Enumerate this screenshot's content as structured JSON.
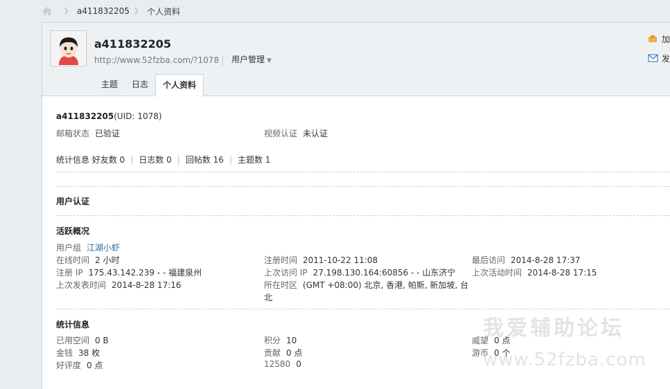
{
  "breadcrumb": {
    "items": [
      "a411832205",
      "个人资料"
    ]
  },
  "header": {
    "username": "a411832205",
    "url": "http://www.52fzba.com/?1078",
    "manage_label": "用户管理",
    "actions": [
      "加",
      "发"
    ]
  },
  "tabs": [
    {
      "label": "主题"
    },
    {
      "label": "日志"
    },
    {
      "label": "个人资料",
      "active": true
    }
  ],
  "info": {
    "name": "a411832205",
    "uid": "(UID: 1078)",
    "email_label": "邮箱状态",
    "email_value": "已验证",
    "video_label": "视频认证",
    "video_value": "未认证",
    "stats_label": "统计信息",
    "stats": [
      "好友数 0",
      "日志数 0",
      "回帖数 16",
      "主题数 1"
    ]
  },
  "verification": {
    "title": "用户认证"
  },
  "activity": {
    "title": "活跃概况",
    "group_label": "用户组",
    "group_value": "江湖小虾",
    "online_label": "在线时间",
    "online_value": "2 小时",
    "reg_time_label": "注册时间",
    "reg_time_value": "2011-10-22 11:08",
    "last_visit_label": "最后访问",
    "last_visit_value": "2014-8-28 17:37",
    "reg_ip_label": "注册 IP",
    "reg_ip_value": "175.43.142.239 - - 福建泉州",
    "last_ip_label": "上次访问 IP",
    "last_ip_value": "27.198.130.164:60856 - - 山东济宁",
    "last_active_label": "上次活动时间",
    "last_active_value": "2014-8-28 17:15",
    "last_post_label": "上次发表时间",
    "last_post_value": "2014-8-28 17:16",
    "timezone_label": "所在时区",
    "timezone_value_line1": "(GMT +08:00) 北京, 香港, 帕斯, 新加坡, 台",
    "timezone_value_line2": "北"
  },
  "statistics": {
    "title": "统计信息",
    "space_label": "已用空间",
    "space_value": "0 B",
    "points_label": "积分",
    "points_value": "10",
    "prestige_label": "威望",
    "prestige_value": "0 点",
    "money_label": "金钱",
    "money_value": "38 枚",
    "contrib_label": "贡献",
    "contrib_value": "0 点",
    "coins_label": "游币",
    "coins_value": "0 个",
    "rating_label": "好评度",
    "rating_value": "0 点",
    "extra_label": "12580",
    "extra_value": "0"
  },
  "watermark": {
    "line1": "我爱辅助论坛",
    "line2": "www.52fzba.com"
  },
  "colors": {
    "link": "#2a6a9b",
    "header_bg": "#eef1f4",
    "page_bg": "#e9edf2"
  }
}
